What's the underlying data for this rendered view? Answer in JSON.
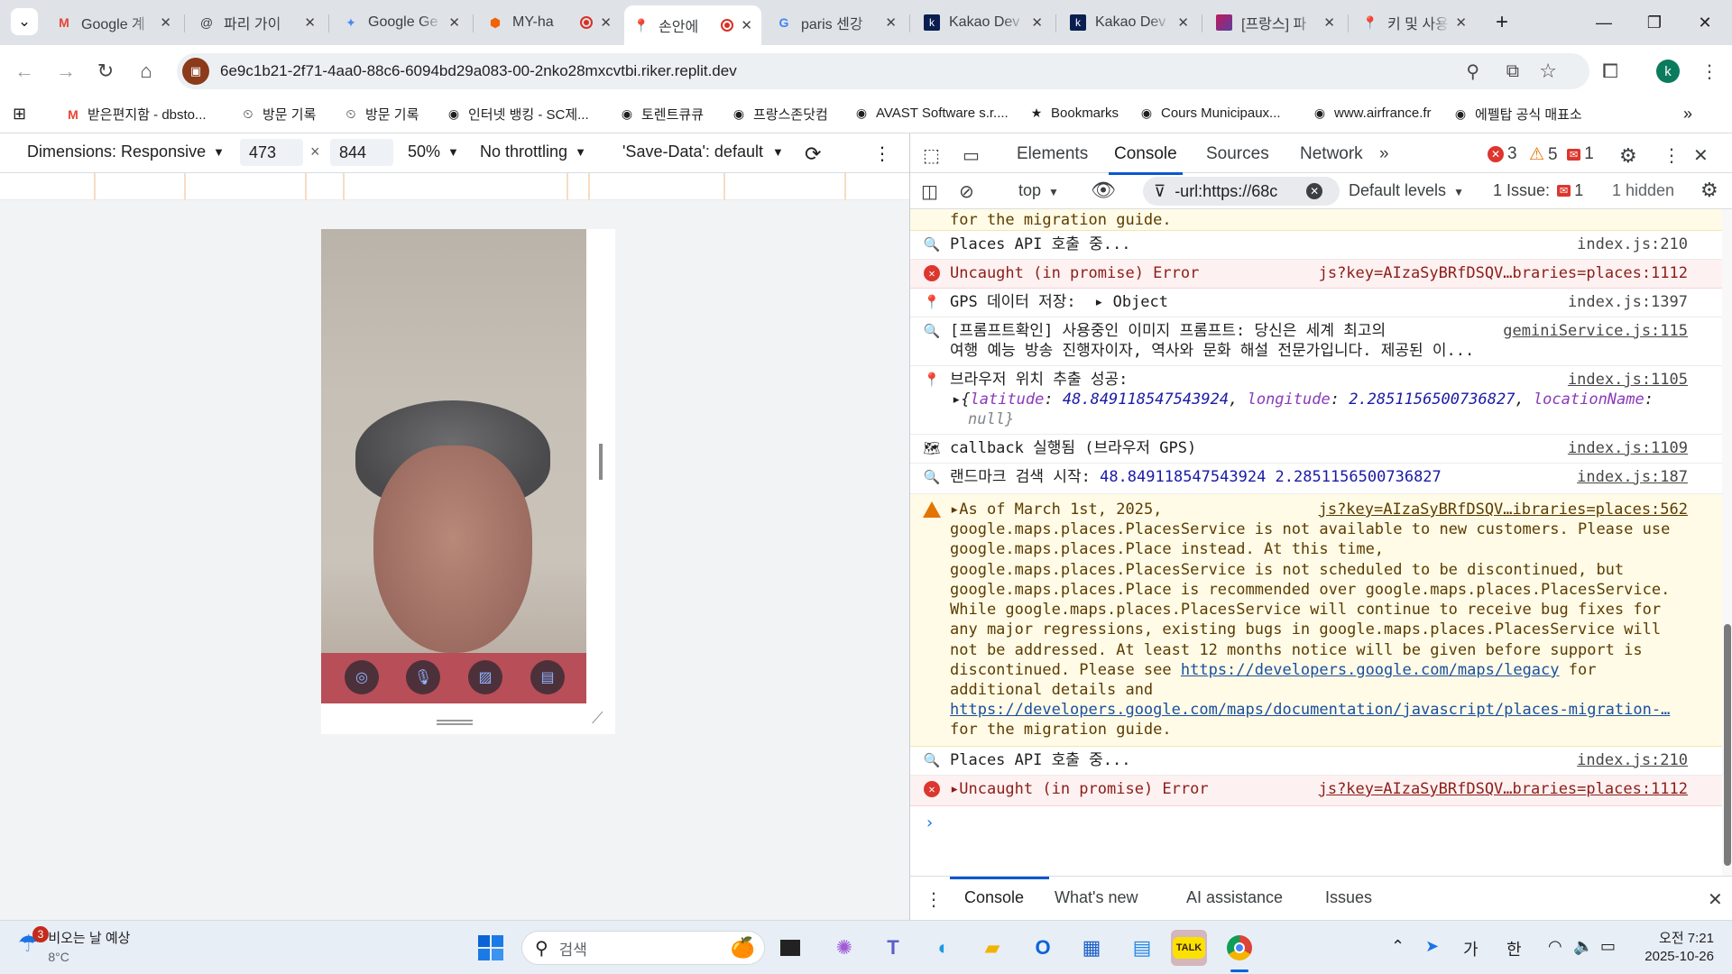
{
  "tabs": [
    {
      "title": "Google 계",
      "icon": "gmail-icon"
    },
    {
      "title": "파리 가이",
      "icon": "threads-icon"
    },
    {
      "title": "Google Ge",
      "icon": "gemini-icon"
    },
    {
      "title": "MY-ha",
      "icon": "replit-icon"
    },
    {
      "title": "손안에",
      "icon": "maps-pin-icon"
    },
    {
      "title": "paris 센강",
      "icon": "google-icon"
    },
    {
      "title": "Kakao Dev",
      "icon": "kakao-icon"
    },
    {
      "title": "Kakao Dev",
      "icon": "kakao-icon"
    },
    {
      "title": "[프랑스] 파",
      "icon": "bookmark-icon"
    },
    {
      "title": "키 및 사용",
      "icon": "maps-pin-icon"
    }
  ],
  "address": {
    "url": "6e9c1b21-2f71-4aa0-88c6-6094bd29a083-00-2nko28mxcvtbi.riker.replit.dev"
  },
  "profile_initial": "k",
  "bookmarks": [
    {
      "label": "받은편지함 - dbsto...",
      "icon": "gmail-icon"
    },
    {
      "label": "방문 기록",
      "icon": "history-icon"
    },
    {
      "label": "방문 기록",
      "icon": "history-icon"
    },
    {
      "label": "인터넷 뱅킹 - SC제...",
      "icon": "globe-icon"
    },
    {
      "label": "토렌트큐큐",
      "icon": "globe-icon"
    },
    {
      "label": "프랑스존닷컴",
      "icon": "globe-icon"
    },
    {
      "label": "AVAST Software s.r....",
      "icon": "globe-icon"
    },
    {
      "label": "Bookmarks",
      "icon": "star-icon"
    },
    {
      "label": "Cours Municipaux...",
      "icon": "globe-icon"
    },
    {
      "label": "www.airfrance.fr",
      "icon": "globe-icon"
    },
    {
      "label": "에펠탑 공식 매표소",
      "icon": "globe-icon"
    }
  ],
  "device_toolbar": {
    "dimensions": "Dimensions: Responsive",
    "width": "473",
    "height": "844",
    "zoom": "50%",
    "throttling": "No throttling",
    "save_data": "'Save-Data': default"
  },
  "devtools": {
    "tabs": [
      "Elements",
      "Console",
      "Sources",
      "Network"
    ],
    "active_tab": "Console",
    "errors": "3",
    "warnings": "5",
    "issues_count": "1",
    "context": "top",
    "filter": "-url:https://68c",
    "levels": "Default levels",
    "issue_label": "1 Issue:",
    "issue_badge": "1",
    "hidden": "1 hidden"
  },
  "console": {
    "r0": "for the migration guide.",
    "r1_msg": "Places API 호출 중...",
    "r1_src": "index.js:210",
    "r2_msg": "Uncaught (in promise) Error",
    "r2_src": "js?key=AIzaSyBRfDSQV…braries=places:1112",
    "r3_msg": "GPS 데이터 저장:",
    "r3_obj": "Object",
    "r3_src": "index.js:1397",
    "r4_line1": "[프롬프트확인] 사용중인 이미지 프롬프트: 당신은 세계 최고의",
    "r4_line2": "여행 예능 방송 진행자이자, 역사와 문화 해설 전문가입니다. 제공된 이...",
    "r4_src": "geminiService.js:115",
    "r5_msg": "브라우저 위치 추출 성공:",
    "r5_src": "index.js:1105",
    "r5_lat_key": "latitude",
    "r5_lat": "48.849118547543924",
    "r5_lon_key": "longitude",
    "r5_lon": "2.2851156500736827",
    "r5_loc_key": "locationName",
    "r5_null": "null",
    "r6_msg": "callback 실행됨 (브라우저 GPS)",
    "r6_src": "index.js:1109",
    "r7_msg": "랜드마크 검색 시작:",
    "r7_nums": "48.849118547543924 2.2851156500736827",
    "r7_src": "index.js:187",
    "warn_head": "As of March 1st, 2025,",
    "warn_src": "js?key=AIzaSyBRfDSQV…ibraries=places:562",
    "warn_lines": [
      "google.maps.places.PlacesService is not available to new customers. Please use",
      "google.maps.places.Place instead. At this time,",
      "google.maps.places.PlacesService is not scheduled to be discontinued, but",
      "google.maps.places.Place is recommended over google.maps.places.PlacesService.",
      "While google.maps.places.PlacesService will continue to receive bug fixes for",
      "any major regressions, existing bugs in google.maps.places.PlacesService will",
      "not be addressed. At least 12 months notice will be given before support is"
    ],
    "warn_please": "discontinued. Please see ",
    "warn_link1": "https://developers.google.com/maps/legacy",
    "warn_for": " for",
    "warn_additional": "additional details and",
    "warn_link2": "https://developers.google.com/maps/documentation/javascript/places-migration-…",
    "warn_tail": "for the migration guide.",
    "r9_msg": "Places API 호출 중...",
    "r9_src": "index.js:210",
    "r10_msg": "Uncaught (in promise) Error",
    "r10_src": "js?key=AIzaSyBRfDSQV…braries=places:1112"
  },
  "drawer": {
    "tabs": [
      "Console",
      "What's new",
      "AI assistance",
      "Issues"
    ],
    "active": "Console"
  },
  "taskbar": {
    "weather_badge": "3",
    "weather_title": "비오는 날 예상",
    "weather_temp": "8°C",
    "search_placeholder": "검색",
    "ime1": "가",
    "ime2": "한",
    "time": "오전 7:21",
    "date": "2025-10-26"
  }
}
